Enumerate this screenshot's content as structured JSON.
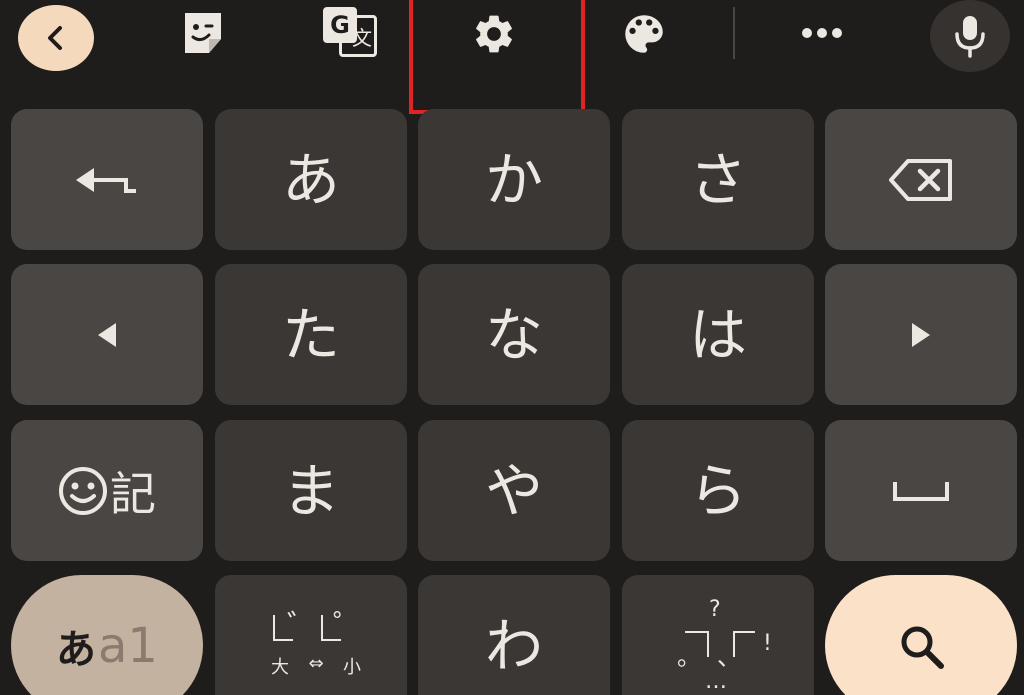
{
  "toolbar": {
    "icons": [
      "back-icon",
      "sticker-icon",
      "translate-icon",
      "settings-icon",
      "palette-icon",
      "more-icon",
      "microphone-icon"
    ],
    "translate_glyph": "G",
    "translate_glyph_2": "文"
  },
  "keys": {
    "a": "あ",
    "ka": "か",
    "sa": "さ",
    "ta": "た",
    "na": "な",
    "ha": "は",
    "ma": "ま",
    "ya": "や",
    "ra": "ら",
    "wa": "わ",
    "symbols_label": "記",
    "mode_kana": "あ",
    "mode_alnum": "a1",
    "dakuten_big": "大",
    "dakuten_arrow": "⇔",
    "dakuten_small": "小",
    "dakuten_mark": "゛",
    "handakuten_mark": "゜",
    "punct_question": "?",
    "punct_period": "。",
    "punct_comma": "、",
    "punct_exclaim": "!",
    "punct_ellipsis": "…"
  },
  "colors": {
    "background": "#1f1d1b",
    "key": "#3a3734",
    "function_key": "#4a4643",
    "back_button": "#f5d9bd",
    "search_button": "#fbe1c7",
    "mode_button": "#c4b2a1",
    "highlight": "#e02424"
  }
}
